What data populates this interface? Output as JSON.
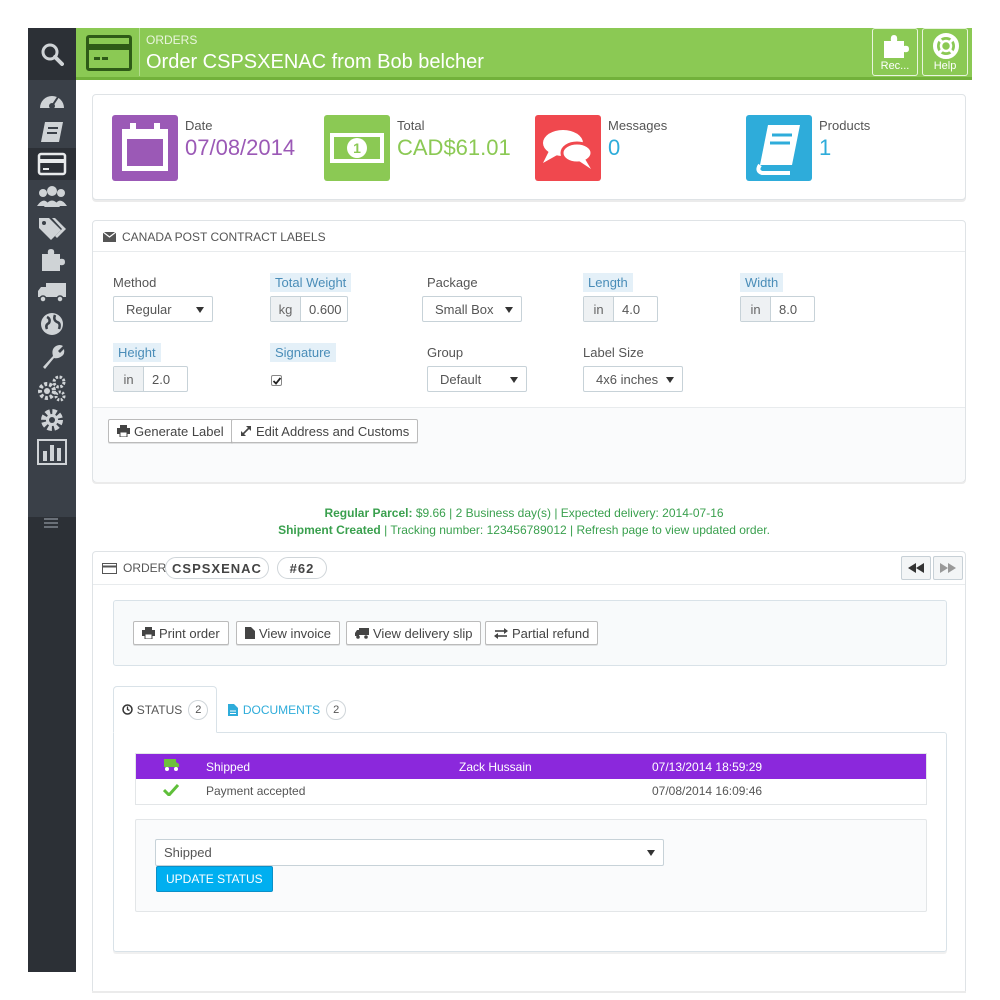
{
  "header": {
    "breadcrumb": "ORDERS",
    "title": "Order CSPSXENAC from Bob belcher",
    "buttons": [
      {
        "label": "Rec...",
        "icon": "puzzle-icon"
      },
      {
        "label": "Help",
        "icon": "lifebuoy-icon"
      }
    ]
  },
  "kpis": [
    {
      "label": "Date",
      "value": "07/08/2014",
      "color": "#9b59b6",
      "icon": "calendar-icon"
    },
    {
      "label": "Total",
      "value": "CAD$61.01",
      "color": "#8bc954",
      "icon": "money-icon"
    },
    {
      "label": "Messages",
      "value": "0",
      "color": "#f0484e",
      "icon": "comments-icon"
    },
    {
      "label": "Products",
      "value": "1",
      "color": "#2eacda",
      "icon": "book-icon"
    }
  ],
  "canada_post": {
    "heading": "CANADA POST CONTRACT LABELS",
    "method": {
      "label": "Method",
      "value": "Regular"
    },
    "total_weight": {
      "label": "Total Weight",
      "unit": "kg",
      "value": "0.600"
    },
    "package": {
      "label": "Package",
      "value": "Small Box"
    },
    "length": {
      "label": "Length",
      "unit": "in",
      "value": "4.0"
    },
    "width": {
      "label": "Width",
      "unit": "in",
      "value": "8.0"
    },
    "height": {
      "label": "Height",
      "unit": "in",
      "value": "2.0"
    },
    "signature": {
      "label": "Signature",
      "checked": true
    },
    "group": {
      "label": "Group",
      "value": "Default"
    },
    "label_size": {
      "label": "Label Size",
      "value": "4x6 inches"
    },
    "generate_label": "Generate Label",
    "edit_address": "Edit Address and Customs"
  },
  "shipment_info": {
    "rate_label": "Regular Parcel:",
    "rate_text": " $9.66 | 2 Business day(s) | Expected delivery: 2014-07-16",
    "created_label": "Shipment Created",
    "created_text": " | Tracking number: 123456789012 | Refresh page to view updated order."
  },
  "order": {
    "heading": "ORDER",
    "reference": "CSPSXENAC",
    "number": "#62",
    "actions": {
      "print": "Print order",
      "invoice": "View invoice",
      "delivery": "View delivery slip",
      "refund": "Partial refund"
    },
    "tabs": [
      {
        "label": "STATUS",
        "count": "2"
      },
      {
        "label": "DOCUMENTS",
        "count": "2"
      }
    ],
    "history": [
      {
        "status": "Shipped",
        "employee": "Zack Hussain",
        "date": "07/13/2014 18:59:29"
      },
      {
        "status": "Payment accepted",
        "employee": "",
        "date": "07/08/2014 16:09:46"
      }
    ],
    "status_select": "Shipped",
    "update_button": "UPDATE STATUS"
  },
  "colors": {
    "header": "#8bc954",
    "sidebar": "#2c3036",
    "shipped_row": "#8b28dc",
    "update_button": "#00aff0"
  }
}
